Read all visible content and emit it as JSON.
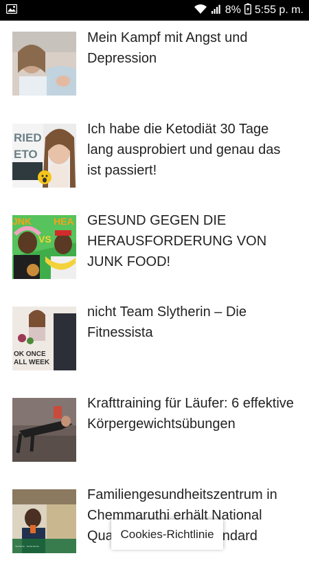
{
  "status": {
    "battery": "8%",
    "time": "5:55 p. m."
  },
  "articles": [
    {
      "title": "Mein Kampf mit Angst und Depression"
    },
    {
      "title": "Ich habe die Ketodiät 30 Tage lang ausprobiert und genau das ist passiert!"
    },
    {
      "title": "GESUND GEGEN DIE HERAUSFORDERUNG VON JUNK FOOD!"
    },
    {
      "title": "nicht Team Slytherin – Die Fitnessista"
    },
    {
      "title": "Krafttraining für Läufer: 6 effektive Körpergewichtsübungen"
    },
    {
      "title": "Familiengesundheitszentrum in Chemmaruthi erhält National Quality Assurance Standard"
    }
  ],
  "cookie": {
    "label": "Cookies-Richtlinie"
  }
}
